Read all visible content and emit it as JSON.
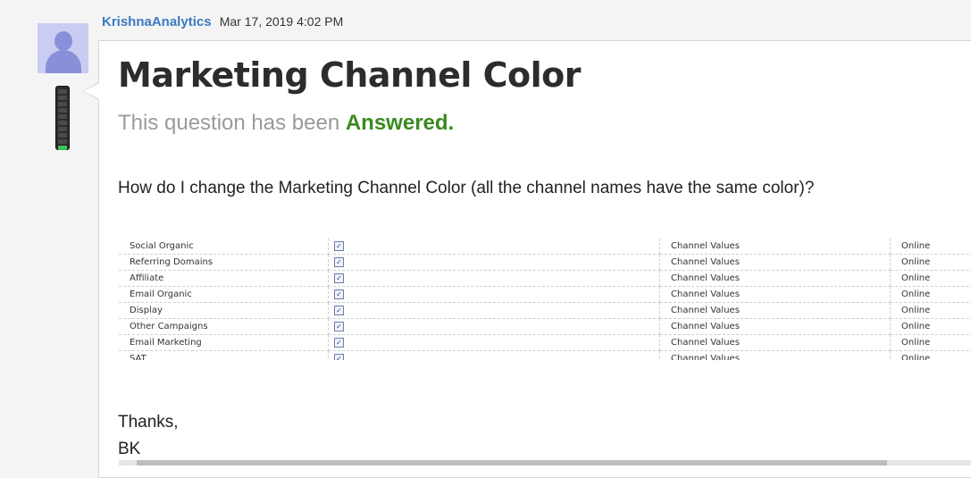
{
  "post": {
    "author": "KrishnaAnalytics",
    "date": "Mar 17, 2019 4:02 PM",
    "rank_level": 1,
    "rank_max": 10,
    "title": "Marketing Channel Color",
    "status_prefix": "This question has been",
    "status_value": "Answered.",
    "question": "How do I change the Marketing Channel Color (all the channel names have the same color)?",
    "signoff": [
      "Thanks,",
      "BK"
    ]
  },
  "channel_table": {
    "rows": [
      {
        "name": "Social Organic",
        "checked": true,
        "type": "Channel Values",
        "status": "Online"
      },
      {
        "name": "Referring Domains",
        "checked": true,
        "type": "Channel Values",
        "status": "Online"
      },
      {
        "name": "Affiliate",
        "checked": true,
        "type": "Channel Values",
        "status": "Online"
      },
      {
        "name": "Email Organic",
        "checked": true,
        "type": "Channel Values",
        "status": "Online"
      },
      {
        "name": "Display",
        "checked": true,
        "type": "Channel Values",
        "status": "Online"
      },
      {
        "name": "Other Campaigns",
        "checked": true,
        "type": "Channel Values",
        "status": "Online"
      },
      {
        "name": "Email Marketing",
        "checked": true,
        "type": "Channel Values",
        "status": "Online"
      },
      {
        "name": "SAT",
        "checked": true,
        "type": "Channel Values",
        "status": "Online"
      }
    ],
    "check_glyph": "✓"
  },
  "colors": {
    "author": "#3a7bbf",
    "answered": "#3a8a1f",
    "status_gray": "#9a9a9a",
    "rank_on": "#3cc25a"
  }
}
